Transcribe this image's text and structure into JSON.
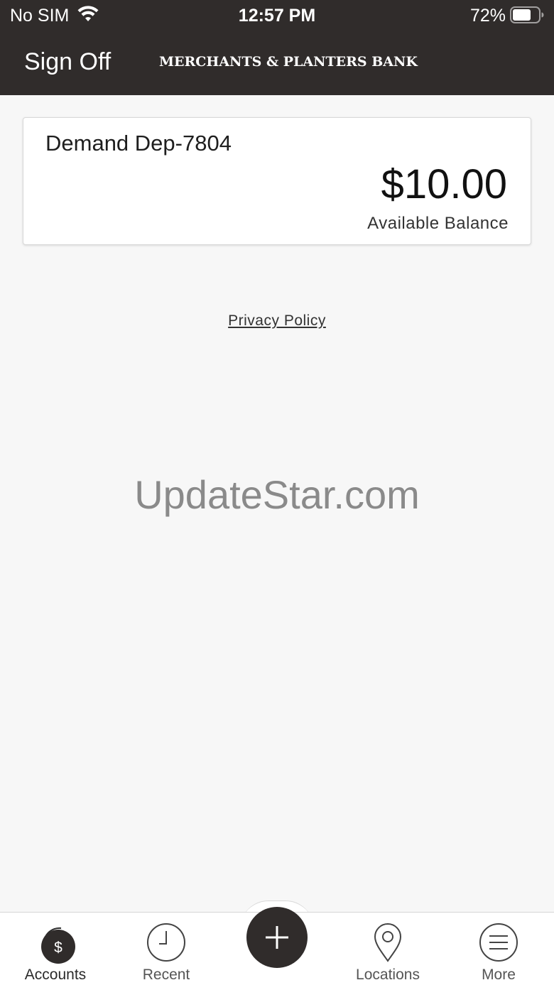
{
  "status_bar": {
    "carrier": "No SIM",
    "time": "12:57 PM",
    "battery_percent": "72%",
    "battery_level": 0.72
  },
  "header": {
    "sign_off_label": "Sign Off",
    "brand": "MERCHANTS & PLANTERS BANK",
    "background_color": "#302c2b"
  },
  "account": {
    "name": "Demand Dep-7804",
    "balance": "$10.00",
    "balance_label": "Available Balance"
  },
  "links": {
    "privacy_policy": "Privacy Policy"
  },
  "watermark": "UpdateStar.com",
  "tab_bar": {
    "tabs": [
      {
        "label": "Accounts",
        "icon": "accounts-dollar-icon",
        "active": true
      },
      {
        "label": "Recent",
        "icon": "clock-icon",
        "active": false
      },
      {
        "label": "Locations",
        "icon": "location-pin-icon",
        "active": false
      },
      {
        "label": "More",
        "icon": "menu-icon",
        "active": false
      }
    ],
    "fab_icon": "plus-icon"
  }
}
